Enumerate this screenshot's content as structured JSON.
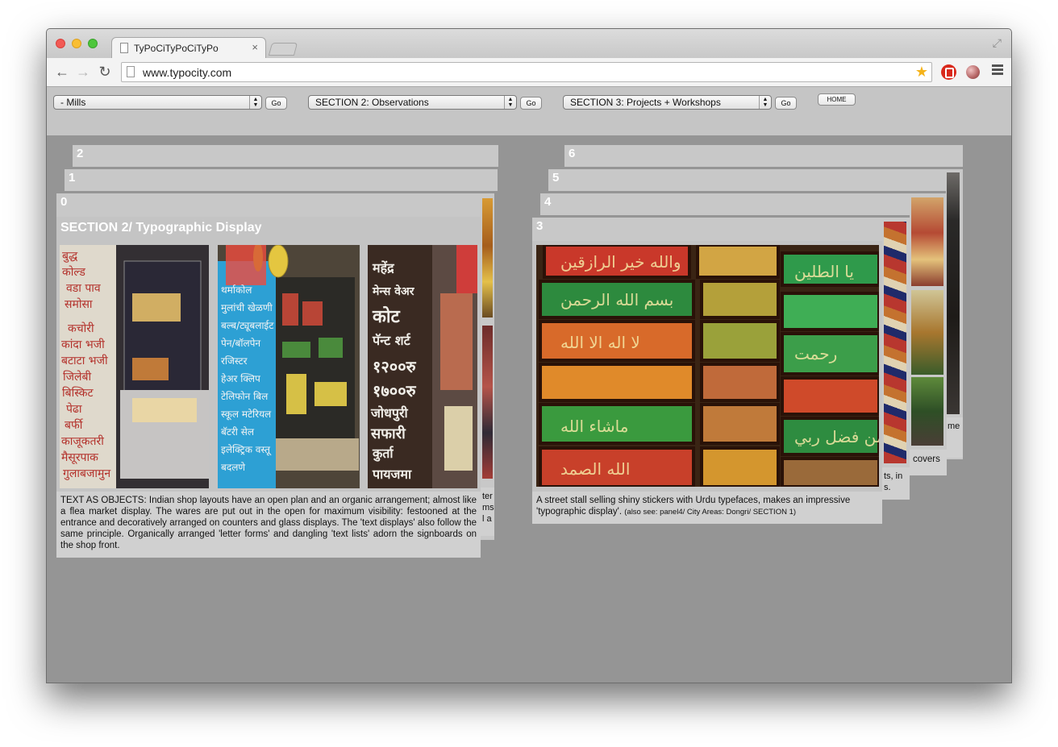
{
  "browser": {
    "tab_title": "TyPoCiTyPoCiTyPo",
    "tab_close": "×",
    "url": "www.typocity.com",
    "icons": [
      "back-arrow-icon",
      "forward-arrow-icon",
      "reload-icon",
      "star-icon",
      "adblock-icon",
      "extension-icon",
      "menu-icon",
      "fullscreen-icon"
    ]
  },
  "nav": {
    "select1": "- Mills",
    "select2": "SECTION 2: Observations",
    "select3": "SECTION 3: Projects + Workshops",
    "go_label": "Go",
    "home_label": "HOME"
  },
  "panels": {
    "p0_num": "0",
    "p1_num": "1",
    "p2_num": "2",
    "p3_num": "3",
    "p4_num": "4",
    "p5_num": "5",
    "p6_num": "6"
  },
  "panel0": {
    "heading": "SECTION 2/ Typographic Display",
    "caption": "TEXT AS OBJECTS: Indian shop layouts have an open plan and an organic arrangement; almost like a flea market display. The wares are put out in the open for maximum visibility: festooned at the entrance and decoratively arranged on counters and glass displays. The 'text displays' also follow the same principle. Organically arranged 'letter forms' and dangling 'text lists' adorn the signboards on the shop front.",
    "peek_caption_lines": [
      "ter",
      "ms",
      "l a"
    ]
  },
  "panel3": {
    "caption_main": "A street stall selling shiny stickers with Urdu typefaces, makes an impressive 'typographic display'.",
    "caption_small": "(also see: panel4/ City Areas: Dongri/ SECTION 1)",
    "peek4_lines": [
      "ts, in",
      "s."
    ],
    "peek5_text": "covers",
    "peek6_text": "me"
  },
  "colors": {
    "page_bg": "#959595",
    "panel_bg": "#c8c8c8",
    "header_bg": "#c5c5c5"
  }
}
